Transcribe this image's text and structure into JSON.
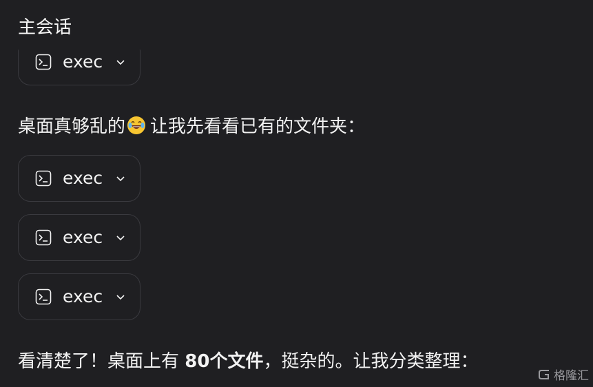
{
  "header": {
    "title": "主会话"
  },
  "tool_calls": [
    {
      "label": "exec",
      "icon": "terminal-icon",
      "expand_icon": "chevron-down-icon"
    },
    {
      "label": "exec",
      "icon": "terminal-icon",
      "expand_icon": "chevron-down-icon"
    },
    {
      "label": "exec",
      "icon": "terminal-icon",
      "expand_icon": "chevron-down-icon"
    },
    {
      "label": "exec",
      "icon": "terminal-icon",
      "expand_icon": "chevron-down-icon"
    }
  ],
  "messages": {
    "first": {
      "before_emoji": "桌面真够乱的",
      "emoji": "face-with-tears-of-joy",
      "after_emoji": "让我先看看已有的文件夹："
    },
    "second": {
      "prefix": "看清楚了！桌面上有 ",
      "bold": "80个文件",
      "suffix": "，挺杂的。让我分类整理："
    }
  },
  "watermark": {
    "text": "格隆汇"
  },
  "colors": {
    "background": "#1f1f22",
    "card_border": "#3a3a3f",
    "text": "#f2f2f2"
  }
}
